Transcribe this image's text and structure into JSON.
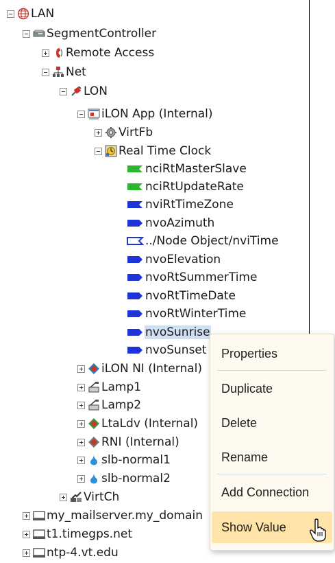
{
  "tree": [
    {
      "label": "LAN",
      "icon": "globe-icon",
      "expander": "minus"
    },
    {
      "label": "SegmentController",
      "icon": "controller-icon",
      "expander": "minus"
    },
    {
      "label": "Remote Access",
      "icon": "phone-icon",
      "expander": "plus"
    },
    {
      "label": "Net",
      "icon": "network-icon",
      "expander": "minus"
    },
    {
      "label": "LON",
      "icon": "plug-icon",
      "expander": "minus"
    },
    {
      "label": "iLON App (Internal)",
      "icon": "app-icon",
      "expander": "minus"
    },
    {
      "label": "VirtFb",
      "icon": "gear-icon",
      "expander": "plus"
    },
    {
      "label": "Real Time Clock",
      "icon": "clock-icon",
      "expander": "minus"
    },
    {
      "label": "nciRtMasterSlave",
      "icon": "config-flag-icon",
      "expander": ""
    },
    {
      "label": "nciRtUpdateRate",
      "icon": "config-flag-icon",
      "expander": ""
    },
    {
      "label": "nviRtTimeZone",
      "icon": "input-flag-icon",
      "expander": ""
    },
    {
      "label": "nvoAzimuth",
      "icon": "output-flag-icon",
      "expander": ""
    },
    {
      "label": "../Node Object/nviTime",
      "icon": "input-flag-icon",
      "expander": ""
    },
    {
      "label": "nvoElevation",
      "icon": "output-flag-icon",
      "expander": ""
    },
    {
      "label": "nvoRtSummerTime",
      "icon": "output-flag-icon",
      "expander": ""
    },
    {
      "label": "nvoRtTimeDate",
      "icon": "output-flag-icon",
      "expander": ""
    },
    {
      "label": "nvoRtWinterTime",
      "icon": "output-flag-icon",
      "expander": ""
    },
    {
      "label": "nvoSunrise",
      "icon": "output-flag-icon",
      "expander": ""
    },
    {
      "label": "nvoSunset",
      "icon": "output-flag-icon",
      "expander": ""
    },
    {
      "label": "iLON NI (Internal)",
      "icon": "ni-icon",
      "expander": "plus"
    },
    {
      "label": "Lamp1",
      "icon": "lamp-icon",
      "expander": "plus"
    },
    {
      "label": "Lamp2",
      "icon": "lamp-icon",
      "expander": "plus"
    },
    {
      "label": "LtaLdv (Internal)",
      "icon": "ldv-icon",
      "expander": "plus"
    },
    {
      "label": "RNI (Internal)",
      "icon": "rni-icon",
      "expander": "plus"
    },
    {
      "label": "slb-normal1",
      "icon": "slb-icon",
      "expander": "plus"
    },
    {
      "label": "slb-normal2",
      "icon": "slb-icon",
      "expander": "plus"
    },
    {
      "label": "VirtCh",
      "icon": "channel-icon",
      "expander": "plus"
    },
    {
      "label": "my_mailserver.my_domain",
      "icon": "server-icon",
      "expander": "plus"
    },
    {
      "label": "t1.timegps.net",
      "icon": "server-icon",
      "expander": "plus"
    },
    {
      "label": "ntp-4.vt.edu",
      "icon": "server-icon",
      "expander": "plus"
    }
  ],
  "context_menu": {
    "items": [
      {
        "label": "Properties"
      },
      {
        "label": "Duplicate"
      },
      {
        "label": "Delete"
      },
      {
        "label": "Rename"
      },
      {
        "label": "Add Connection"
      },
      {
        "label": "Show Value"
      }
    ],
    "highlighted": "Show Value"
  },
  "selected_item": "nvoSunrise",
  "colors": {
    "selection": "#cfe0f5",
    "menu_bg": "#fffaf0",
    "menu_highlight": "#ffe3a8",
    "config_flag": "#2fb52f",
    "nv_flag": "#1f33d8"
  }
}
